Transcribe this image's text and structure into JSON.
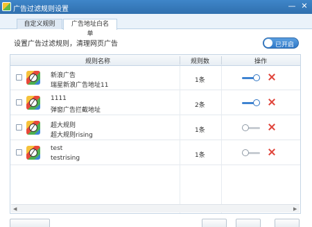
{
  "window": {
    "title": "广告过滤规则设置",
    "minimize_glyph": "—",
    "close_glyph": "✕"
  },
  "tabs": [
    {
      "label": "自定义规则",
      "active": false
    },
    {
      "label": "广告地址白名单",
      "active": true
    }
  ],
  "description": "设置广告过滤规则，清理网页广告",
  "toggle": {
    "label": "已开启",
    "state": "on"
  },
  "table": {
    "headers": {
      "name": "规则名称",
      "count": "规则数",
      "action": "操作"
    },
    "rows": [
      {
        "name": "新浪广告",
        "sub": "瑞星新浪广告地址11",
        "count": "1条",
        "enabled": true
      },
      {
        "name": "1111",
        "sub": "弹窗广告拦截地址",
        "count": "2条",
        "enabled": true
      },
      {
        "name": "超大规则",
        "sub": "超大规则rising",
        "count": "1条",
        "enabled": false
      },
      {
        "name": "test",
        "sub": "testrising",
        "count": "1条",
        "enabled": false
      }
    ]
  },
  "scroll_arrows": {
    "left": "◀",
    "right": "▶"
  },
  "footer_buttons": {
    "add": "",
    "edit": "",
    "remove": "",
    "ok": ""
  },
  "colors": {
    "title_bar": "#3f86c9",
    "accent": "#3e83d1",
    "delete": "#e0453b"
  }
}
